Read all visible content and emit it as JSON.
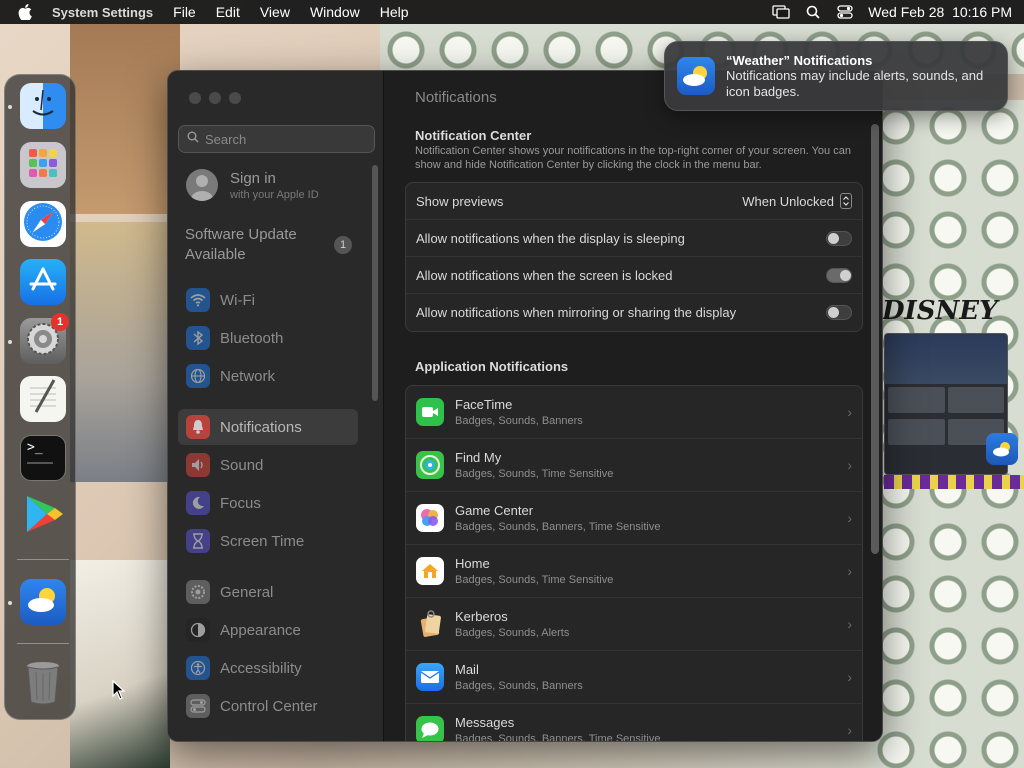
{
  "menubar": {
    "app_name": "System Settings",
    "menus": [
      "File",
      "Edit",
      "View",
      "Window",
      "Help"
    ],
    "clock": "Wed Feb 28  10:16 PM"
  },
  "wallpaper": {
    "disney_text": "DISNEY"
  },
  "dock": {
    "apps": [
      {
        "name": "Finder",
        "icon": "finder-icon"
      },
      {
        "name": "Launchpad",
        "icon": "launchpad-icon"
      },
      {
        "name": "Safari",
        "icon": "safari-icon"
      },
      {
        "name": "App Store",
        "icon": "app-store-icon"
      },
      {
        "name": "System Settings",
        "icon": "settings-gear-icon",
        "badge": "1"
      },
      {
        "name": "TextEdit",
        "icon": "textedit-icon"
      },
      {
        "name": "Terminal",
        "icon": "terminal-icon",
        "glyph": ">_"
      },
      {
        "name": "Google Play",
        "icon": "play-store-icon"
      },
      {
        "name": "Weather",
        "icon": "weather-icon"
      },
      {
        "name": "Trash",
        "icon": "trash-icon"
      }
    ]
  },
  "sidebar": {
    "search_placeholder": "Search",
    "signin_title": "Sign in",
    "signin_sub": "with your Apple ID",
    "software_update": "Software Update Available",
    "software_update_badge": "1",
    "items": [
      {
        "label": "Wi-Fi",
        "icon": "wifi-icon",
        "color": "#1e78e0"
      },
      {
        "label": "Bluetooth",
        "icon": "bluetooth-icon",
        "color": "#1e78e0"
      },
      {
        "label": "Network",
        "icon": "globe-icon",
        "color": "#1e78e0"
      },
      {
        "label": "Notifications",
        "icon": "bell-icon",
        "color": "#e0463d",
        "selected": true
      },
      {
        "label": "Sound",
        "icon": "speaker-icon",
        "color": "#e0463d"
      },
      {
        "label": "Focus",
        "icon": "moon-icon",
        "color": "#5a55d6"
      },
      {
        "label": "Screen Time",
        "icon": "hourglass-icon",
        "color": "#5a55d6"
      },
      {
        "label": "General",
        "icon": "gear-icon",
        "color": "#8a8a8a"
      },
      {
        "label": "Appearance",
        "icon": "appearance-icon",
        "color": "#222222"
      },
      {
        "label": "Accessibility",
        "icon": "accessibility-icon",
        "color": "#1e78e0"
      },
      {
        "label": "Control Center",
        "icon": "control-center-icon",
        "color": "#8a8a8a"
      }
    ]
  },
  "content": {
    "title": "Notifications",
    "nc_heading": "Notification Center",
    "nc_description": "Notification Center shows your notifications in the top-right corner of your screen. You can show and hide Notification Center by clicking the clock in the menu bar.",
    "settings": [
      {
        "label": "Show previews",
        "type": "popup",
        "value": "When Unlocked"
      },
      {
        "label": "Allow notifications when the display is sleeping",
        "type": "toggle",
        "on": false
      },
      {
        "label": "Allow notifications when the screen is locked",
        "type": "toggle",
        "on": true
      },
      {
        "label": "Allow notifications when mirroring or sharing the display",
        "type": "toggle",
        "on": false
      }
    ],
    "app_heading": "Application Notifications",
    "apps": [
      {
        "name": "FaceTime",
        "sub": "Badges, Sounds, Banners",
        "icon": "facetime-icon"
      },
      {
        "name": "Find My",
        "sub": "Badges, Sounds, Time Sensitive",
        "icon": "find-my-icon"
      },
      {
        "name": "Game Center",
        "sub": "Badges, Sounds, Banners, Time Sensitive",
        "icon": "game-center-icon"
      },
      {
        "name": "Home",
        "sub": "Badges, Sounds, Time Sensitive",
        "icon": "home-icon"
      },
      {
        "name": "Kerberos",
        "sub": "Badges, Sounds, Alerts",
        "icon": "kerberos-icon"
      },
      {
        "name": "Mail",
        "sub": "Badges, Sounds, Banners",
        "icon": "mail-icon"
      },
      {
        "name": "Messages",
        "sub": "Badges, Sounds, Banners, Time Sensitive",
        "icon": "messages-icon"
      }
    ]
  },
  "notification": {
    "title": "“Weather” Notifications",
    "body": "Notifications may include alerts, sounds, and icon badges."
  }
}
